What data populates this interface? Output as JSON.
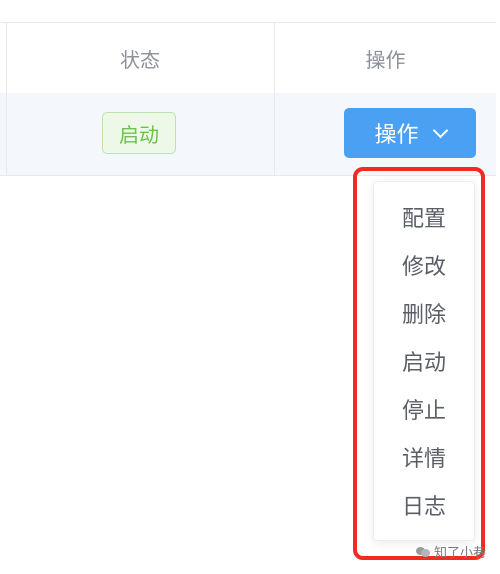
{
  "table": {
    "headers": {
      "status": "状态",
      "actions": "操作"
    },
    "row": {
      "status_tag": "启动",
      "action_button": "操作"
    }
  },
  "dropdown": {
    "items": [
      "配置",
      "修改",
      "删除",
      "启动",
      "停止",
      "详情",
      "日志"
    ]
  },
  "colors": {
    "primary": "#4aa1f3",
    "success_tag_text": "#6dc14a",
    "highlight_border": "#f22b22",
    "row_hover_bg": "#f4f8fd"
  },
  "watermark": {
    "text": "知了小巷"
  }
}
